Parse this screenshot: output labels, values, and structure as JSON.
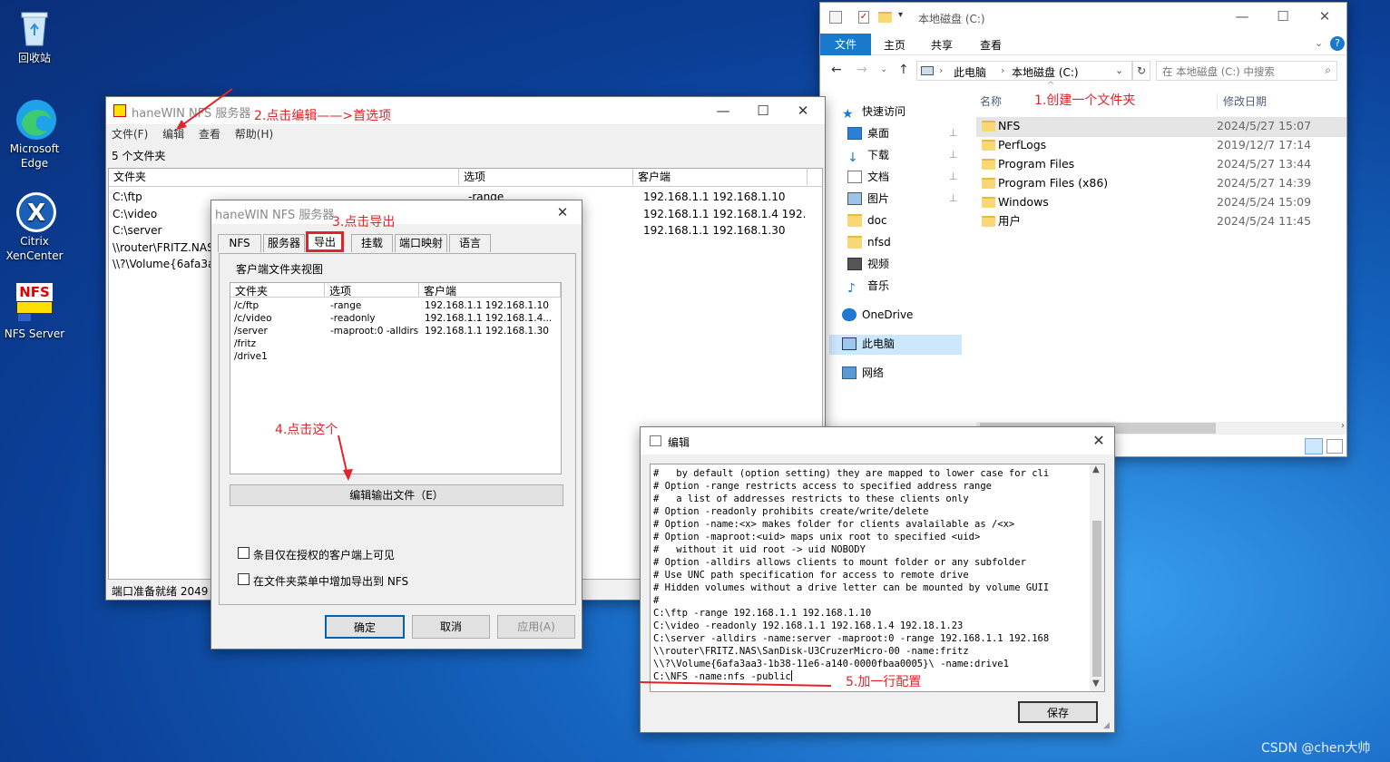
{
  "desktop": {
    "icons": [
      {
        "label": "回收站"
      },
      {
        "label": "Microsoft Edge"
      },
      {
        "label": "Citrix XenCenter"
      },
      {
        "label": "NFS Server"
      }
    ],
    "nfs_icon_text": "NFS"
  },
  "nfs_main": {
    "title": "haneWIN NFS 服务器",
    "menu": [
      "文件(F)",
      "编辑",
      "查看",
      "帮助(H)"
    ],
    "summary": "5 个文件夹",
    "columns": [
      "文件夹",
      "选项",
      "客户端"
    ],
    "rows": [
      {
        "folder": "C:\\ftp",
        "options": "-range",
        "clients": "192.168.1.1 192.168.1.10"
      },
      {
        "folder": "C:\\video",
        "options": "",
        "clients": "192.168.1.1 192.168.1.4 192...."
      },
      {
        "folder": "C:\\server",
        "options": "ot:0 -all...",
        "clients": "192.168.1.1 192.168.1.30"
      },
      {
        "folder": "\\\\router\\FRITZ.NAS",
        "options": "",
        "clients": ""
      },
      {
        "folder": "\\\\?\\Volume{6afa3aa",
        "options": "",
        "clients": ""
      }
    ],
    "status": "端口准备就绪 2049"
  },
  "prefs": {
    "title": "haneWIN NFS 服务器",
    "tabs": [
      "NFS",
      "服务器",
      "导出",
      "挂载",
      "端口映射",
      "语言"
    ],
    "group_label": "客户端文件夹视图",
    "columns": [
      "文件夹",
      "选项",
      "客户端"
    ],
    "rows": [
      {
        "folder": "/c/ftp",
        "options": "-range",
        "clients": "192.168.1.1 192.168.1.10"
      },
      {
        "folder": "/c/video",
        "options": "-readonly",
        "clients": "192.168.1.1 192.168.1.4..."
      },
      {
        "folder": "/server",
        "options": "-maproot:0 -alldirs...",
        "clients": "192.168.1.1 192.168.1.30"
      },
      {
        "folder": "/fritz",
        "options": "",
        "clients": ""
      },
      {
        "folder": "/drive1",
        "options": "",
        "clients": ""
      }
    ],
    "edit_button": "编辑输出文件（E）",
    "checkbox1": "条目仅在授权的客户端上可见",
    "checkbox2": "在文件夹菜单中增加导出到 NFS",
    "ok": "确定",
    "cancel": "取消",
    "apply": "应用(A)"
  },
  "edit": {
    "title": "编辑",
    "lines": [
      "#   by default (option setting) they are mapped to lower case for cli",
      "# Option -range restricts access to specified address range",
      "#   a list of addresses restricts to these clients only",
      "# Option -readonly prohibits create/write/delete",
      "# Option -name:<x> makes folder for clients avalailable as /<x>",
      "# Option -maproot:<uid> maps unix root to specified <uid>",
      "#   without it uid root -> uid NOBODY",
      "# Option -alldirs allows clients to mount folder or any subfolder",
      "# Use UNC path specification for access to remote drive",
      "# Hidden volumes without a drive letter can be mounted by volume GUII",
      "#",
      "C:\\ftp -range 192.168.1.1 192.168.1.10",
      "C:\\video -readonly 192.168.1.1 192.168.1.4 192.18.1.23",
      "C:\\server -alldirs -name:server -maproot:0 -range 192.168.1.1 192.168",
      "\\\\router\\FRITZ.NAS\\SanDisk-U3CruzerMicro-00 -name:fritz",
      "\\\\?\\Volume{6afa3aa3-1b38-11e6-a140-0000fbaa0005}\\ -name:drive1",
      "C:\\NFS -name:nfs -public"
    ],
    "save": "保存"
  },
  "explorer": {
    "title": "本地磁盘 (C:)",
    "ribbon_tabs": [
      "文件",
      "主页",
      "共享",
      "查看"
    ],
    "breadcrumb": [
      "此电脑",
      "本地磁盘 (C:)"
    ],
    "search_placeholder": "在 本地磁盘 (C:) 中搜索",
    "col_name": "名称",
    "col_date": "修改日期",
    "nav": [
      {
        "label": "快速访问",
        "icon": "star-icon"
      },
      {
        "label": "桌面",
        "icon": "desktop-icon"
      },
      {
        "label": "下载",
        "icon": "download-icon"
      },
      {
        "label": "文档",
        "icon": "document-icon"
      },
      {
        "label": "图片",
        "icon": "picture-icon"
      },
      {
        "label": "doc",
        "icon": "folder-icon"
      },
      {
        "label": "nfsd",
        "icon": "folder-icon"
      },
      {
        "label": "视频",
        "icon": "video-icon"
      },
      {
        "label": "音乐",
        "icon": "music-icon"
      },
      {
        "label": "OneDrive",
        "icon": "cloud-icon"
      },
      {
        "label": "此电脑",
        "icon": "computer-icon"
      },
      {
        "label": "网络",
        "icon": "network-icon"
      }
    ],
    "files": [
      {
        "name": "NFS",
        "date": "2024/5/27 15:07"
      },
      {
        "name": "PerfLogs",
        "date": "2019/12/7 17:14"
      },
      {
        "name": "Program Files",
        "date": "2024/5/27 13:44"
      },
      {
        "name": "Program Files (x86)",
        "date": "2024/5/27 14:39"
      },
      {
        "name": "Windows",
        "date": "2024/5/24 15:09"
      },
      {
        "name": "用户",
        "date": "2024/5/24 11:45"
      }
    ]
  },
  "annotations": {
    "a1": "1.创建一个文件夹",
    "a2": "2.点击编辑——>首选项",
    "a3": "3.点击导出",
    "a4": "4.点击这个",
    "a5": "5.加一行配置"
  },
  "watermark": "CSDN @chen大帅",
  "colors": {
    "accent": "#0063b1",
    "annotation": "#e3232a",
    "folder": "#f8d775"
  }
}
